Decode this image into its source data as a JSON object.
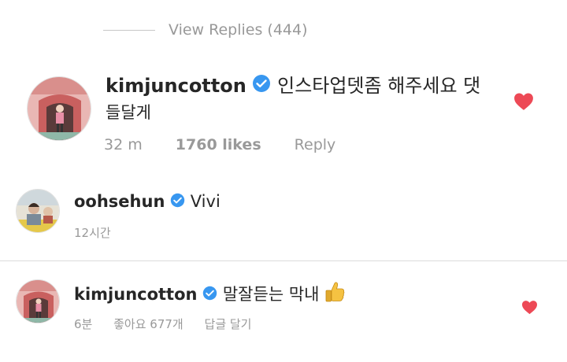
{
  "view_replies": {
    "label": "View Replies (444)"
  },
  "comments": [
    {
      "username": "kimjuncotton",
      "text_line1": "인스타업뎃좀 해주세요 댓",
      "text_line2": "들달게",
      "time": "32 m",
      "likes": "1760 likes",
      "reply": "Reply",
      "liked": true
    },
    {
      "username": "oohsehun",
      "text": "Vivi",
      "time": "12시간"
    },
    {
      "username": "kimjuncotton",
      "text": "말잘듣는 막내",
      "emoji": "👍",
      "time": "6분",
      "likes": "좋아요 677개",
      "reply": "답글 달기",
      "liked": true
    }
  ],
  "colors": {
    "verified": "#3897f0",
    "heart": "#ed4956",
    "muted": "#999999",
    "text": "#262626"
  }
}
